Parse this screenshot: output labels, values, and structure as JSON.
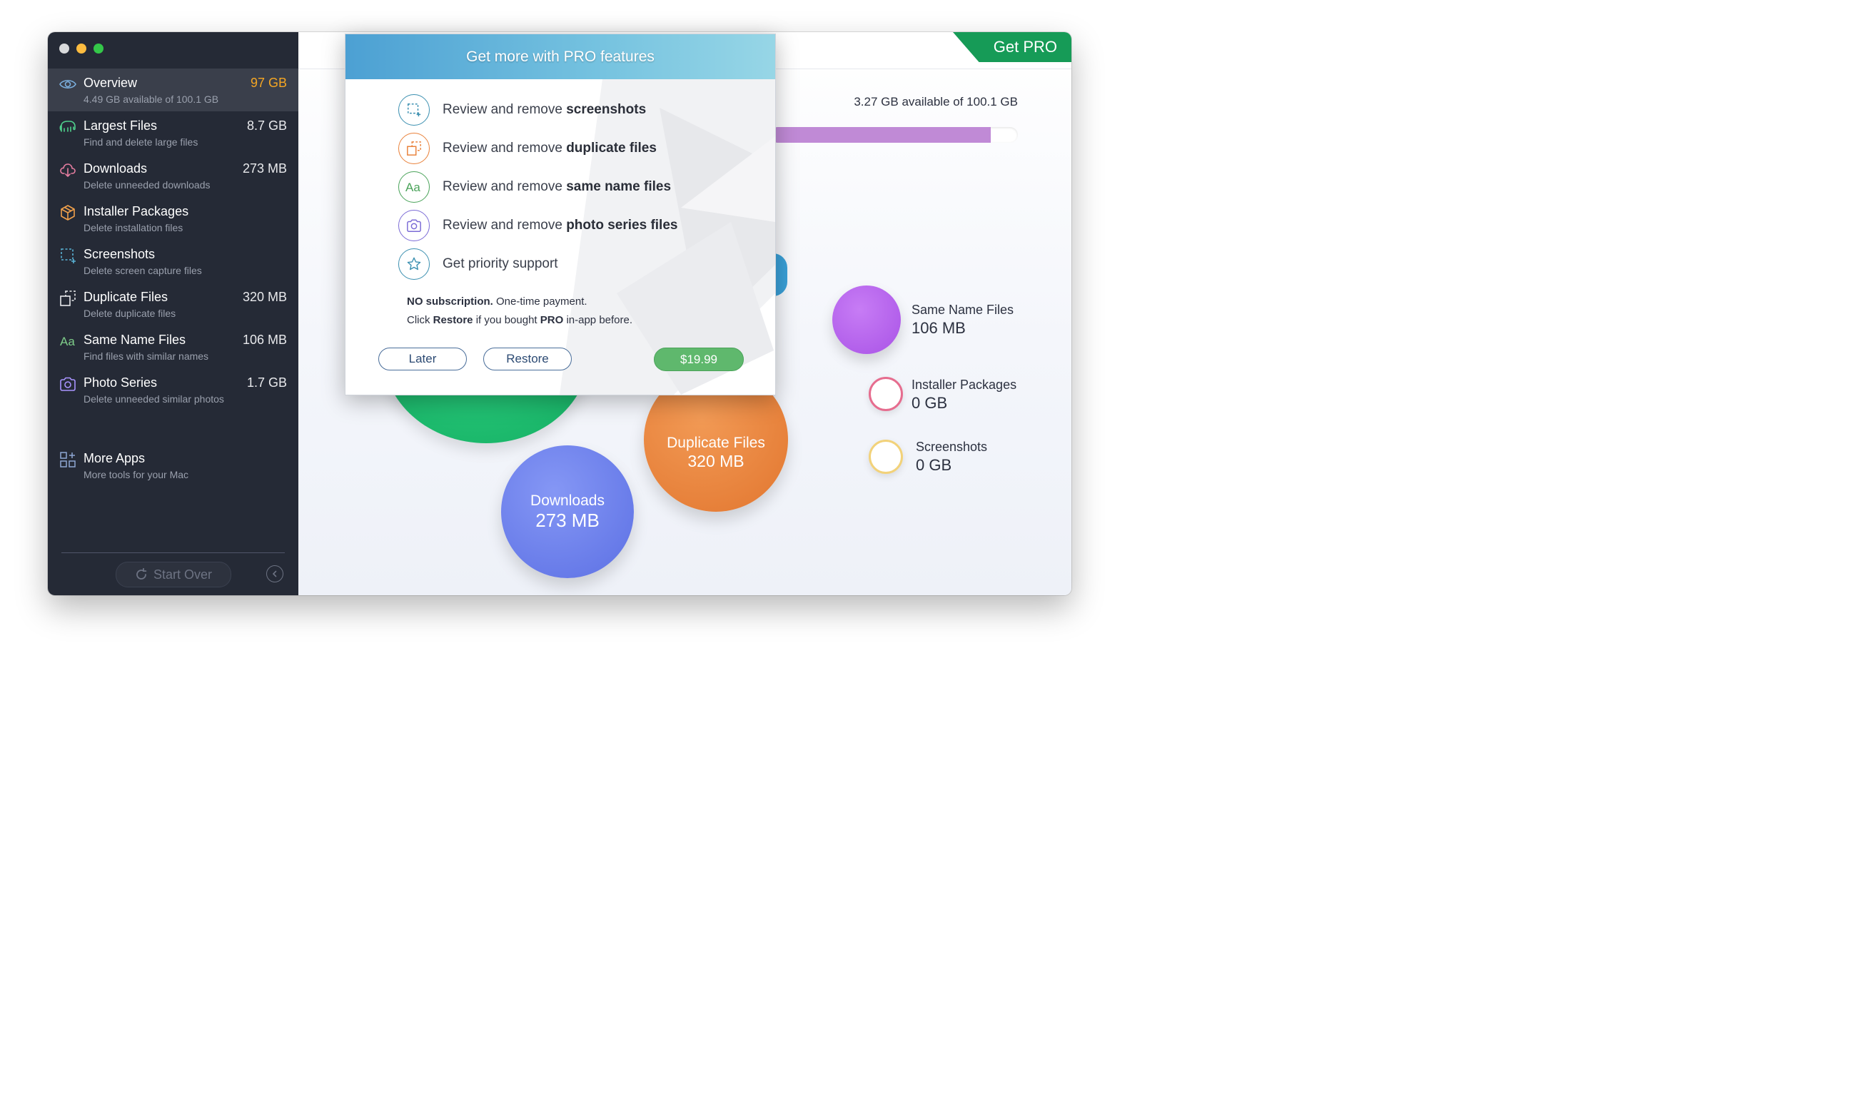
{
  "window": {
    "traffic_lights": [
      "close",
      "minimize",
      "maximize"
    ]
  },
  "sidebar": {
    "items": [
      {
        "title": "Overview",
        "subtitle": "4.49 GB available of 100.1 GB",
        "size": "97 GB",
        "icon": "eye-icon",
        "active": true
      },
      {
        "title": "Largest Files",
        "subtitle": "Find and delete large files",
        "size": "8.7 GB",
        "icon": "elephant-icon"
      },
      {
        "title": "Downloads",
        "subtitle": "Delete unneeded downloads",
        "size": "273 MB",
        "icon": "cloud-download-icon"
      },
      {
        "title": "Installer Packages",
        "subtitle": "Delete installation files",
        "size": "",
        "icon": "package-icon"
      },
      {
        "title": "Screenshots",
        "subtitle": "Delete screen capture files",
        "size": "",
        "icon": "screenshot-icon"
      },
      {
        "title": "Duplicate Files",
        "subtitle": "Delete duplicate files",
        "size": "320 MB",
        "icon": "duplicate-icon"
      },
      {
        "title": "Same Name Files",
        "subtitle": "Find files with similar names",
        "size": "106 MB",
        "icon": "text-aa-icon"
      },
      {
        "title": "Photo Series",
        "subtitle": "Delete unneeded similar photos",
        "size": "1.7 GB",
        "icon": "camera-icon"
      }
    ],
    "more_apps": {
      "title": "More Apps",
      "subtitle": "More tools for your Mac",
      "icon": "apps-grid-icon"
    },
    "start_over": "Start Over"
  },
  "main": {
    "get_pro": "Get PRO",
    "available_text": "3.27 GB available of 100.1 GB",
    "storage_used_fraction": 0.89,
    "bubbles": [
      {
        "name": "Duplicate Files",
        "size": "320 MB",
        "color": "#e9813a"
      },
      {
        "name": "Downloads",
        "size": "273 MB",
        "color": "#6a80ec"
      }
    ],
    "legend": [
      {
        "name": "Same Name Files",
        "size": "106 MB",
        "color": "#b766ec"
      },
      {
        "name": "Installer Packages",
        "size": "0 GB",
        "color": "#e66d8f"
      },
      {
        "name": "Screenshots",
        "size": "0 GB",
        "color": "#f2d27a"
      }
    ],
    "colors": {
      "largest_files_bubble": "#1fbd6e",
      "photo_series_bubble": "#3aa0d8"
    }
  },
  "modal": {
    "title": "Get more with PRO features",
    "features": [
      {
        "prefix": "Review and remove ",
        "bold": "screenshots",
        "icon": "screenshot-icon",
        "color": "#3a8fb0"
      },
      {
        "prefix": "Review and remove ",
        "bold": "duplicate files",
        "icon": "duplicate-icon",
        "color": "#e9813a"
      },
      {
        "prefix": "Review and remove ",
        "bold": "same name files",
        "icon": "text-aa-icon",
        "color": "#4aa35a"
      },
      {
        "prefix": "Review and remove ",
        "bold": "photo series files",
        "icon": "camera-icon",
        "color": "#7b6bd6"
      },
      {
        "prefix": "Get priority support",
        "bold": "",
        "icon": "star-icon",
        "color": "#3a8fb0"
      }
    ],
    "note1_bold": "NO subscription.",
    "note1_rest": " One-time payment.",
    "note2_a": "Click ",
    "note2_b": "Restore",
    "note2_c": " if you bought ",
    "note2_d": "PRO",
    "note2_e": " in-app before.",
    "later_label": "Later",
    "restore_label": "Restore",
    "price_label": "$19.99"
  }
}
